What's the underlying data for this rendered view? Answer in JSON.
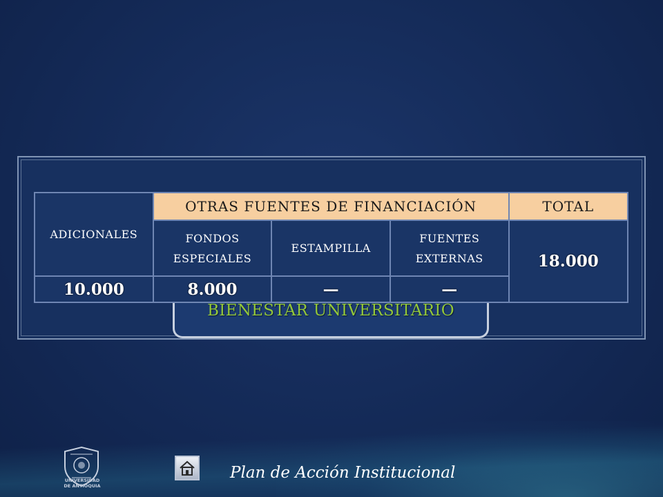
{
  "section_label": "BIENESTAR UNIVERSITARIO",
  "table": {
    "adicionales_header": "ADICIONALES",
    "otras_fuentes_header": "OTRAS FUENTES DE FINANCIACIÓN",
    "total_header": "TOTAL",
    "sub_headers": {
      "fondos_line1": "FONDOS",
      "fondos_line2": "ESPECIALES",
      "estampilla": "ESTAMPILLA",
      "fuentes_line1": "FUENTES",
      "fuentes_line2": "EXTERNAS"
    },
    "values": {
      "adicionales": "10.000",
      "fondos_especiales": "8.000",
      "estampilla": "—",
      "fuentes_externas": "—",
      "total": "18.000"
    }
  },
  "footer": {
    "title": "Plan de Acción Institucional",
    "logo_line1": "UNIVERSIDAD",
    "logo_line2": "DE ANTIOQUIA",
    "home_icon": "home-icon"
  },
  "colors": {
    "background": "#142a57",
    "header_peach": "#f7cfa0",
    "label_green": "#93c73a"
  }
}
